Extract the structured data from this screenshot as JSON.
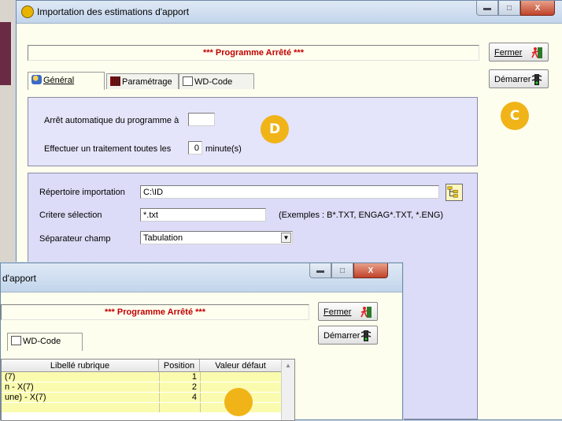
{
  "main_window": {
    "title": "Importation des estimations d'apport",
    "status": "*** Programme Arrêté ***",
    "buttons": {
      "close": "Fermer",
      "start": "Démarrer"
    },
    "tabs": [
      "Général",
      "Paramétrage",
      "WD-Code"
    ],
    "top_panel": {
      "auto_stop_label": "Arrêt automatique du programme à",
      "auto_stop_value": "",
      "treat_every_label": "Effectuer un traitement toutes les",
      "treat_every_value": "0",
      "minutes_label": "minute(s)"
    },
    "bottom_panel": {
      "dir_label": "Répertoire importation",
      "dir_value": "C:\\ID",
      "criteria_label": "Critere sélection",
      "criteria_value": "*.txt",
      "criteria_examples": "(Exemples : B*.TXT, ENGAG*.TXT, *.ENG)",
      "separator_label": "Séparateur champ",
      "separator_value": "Tabulation"
    }
  },
  "badges": {
    "d": "D",
    "c": "C"
  },
  "second_window": {
    "title": "d'apport",
    "status": "*** Programme Arrêté ***",
    "buttons": {
      "close": "Fermer",
      "start": "Démarrer"
    },
    "tab": "WD-Code",
    "columns": [
      "Libellé rubrique",
      "Position",
      "Valeur défaut"
    ],
    "rows": [
      {
        "label": "(7)",
        "position": "1"
      },
      {
        "label": "n - X(7)",
        "position": "2"
      },
      {
        "label": "une) - X(7)",
        "position": "4"
      },
      {
        "label": "",
        "position": ""
      }
    ]
  },
  "colors": {
    "accent_badge": "#f0b418",
    "status_text": "#c00000",
    "panel": "#e4e4fa"
  }
}
